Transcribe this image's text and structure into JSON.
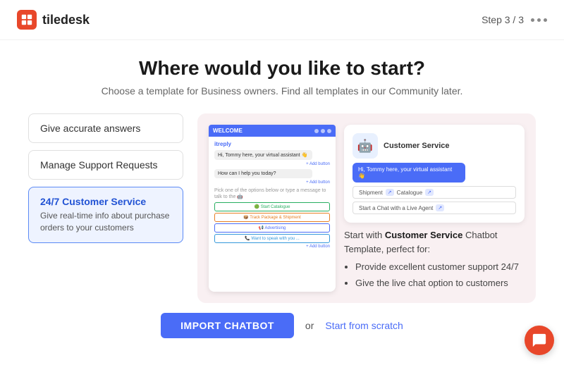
{
  "header": {
    "logo_text": "tiledesk",
    "step_label": "Step  3 / 3"
  },
  "page": {
    "title": "Where would you like to start?",
    "subtitle": "Choose a template for Business owners. Find all templates in our Community later."
  },
  "templates": [
    {
      "id": "accurate",
      "label": "Give accurate answers",
      "active": false
    },
    {
      "id": "support",
      "label": "Manage Support Requests",
      "active": false
    },
    {
      "id": "customer",
      "title": "24/7 Customer Service",
      "desc": "Give real-time info about purchase orders to your customers",
      "active": true
    }
  ],
  "preview": {
    "header_title": "WELCOME",
    "bot_name": "itreply",
    "greeting": "Hi, Tommy here, your virtual assistant 👋",
    "question": "How can I help you today?",
    "add_button": "+ Add button",
    "pick_text": "Pick one of the options below or type a message to talk to the 🤖",
    "btn1": "🟢 Start Catalogue",
    "btn2": "📦 Track Package & Shipment",
    "btn3": "📢 Advertising",
    "btn4": "📞 Want to speak with you ...",
    "add_btn2": "+ Add button"
  },
  "cs_card": {
    "title": "Customer Service",
    "bubble": "Hi, Tommy here, your virtual assistant 👋",
    "option1_label": "Shipment",
    "option1_badge": "↗",
    "option2_label": "Catalogue",
    "option2_badge": "↗",
    "option3_label": "Start a Chat with a Live Agent",
    "option3_badge": "↗"
  },
  "description": {
    "text": "Start with",
    "bold": "Customer Service",
    "text2": "Chatbot Template, perfect for:",
    "bullets": [
      "Provide excellent customer support 24/7",
      "Give the live chat option to customers"
    ]
  },
  "footer": {
    "import_label": "IMPORT CHATBOT",
    "or_text": "or",
    "scratch_label": "Start from scratch"
  }
}
